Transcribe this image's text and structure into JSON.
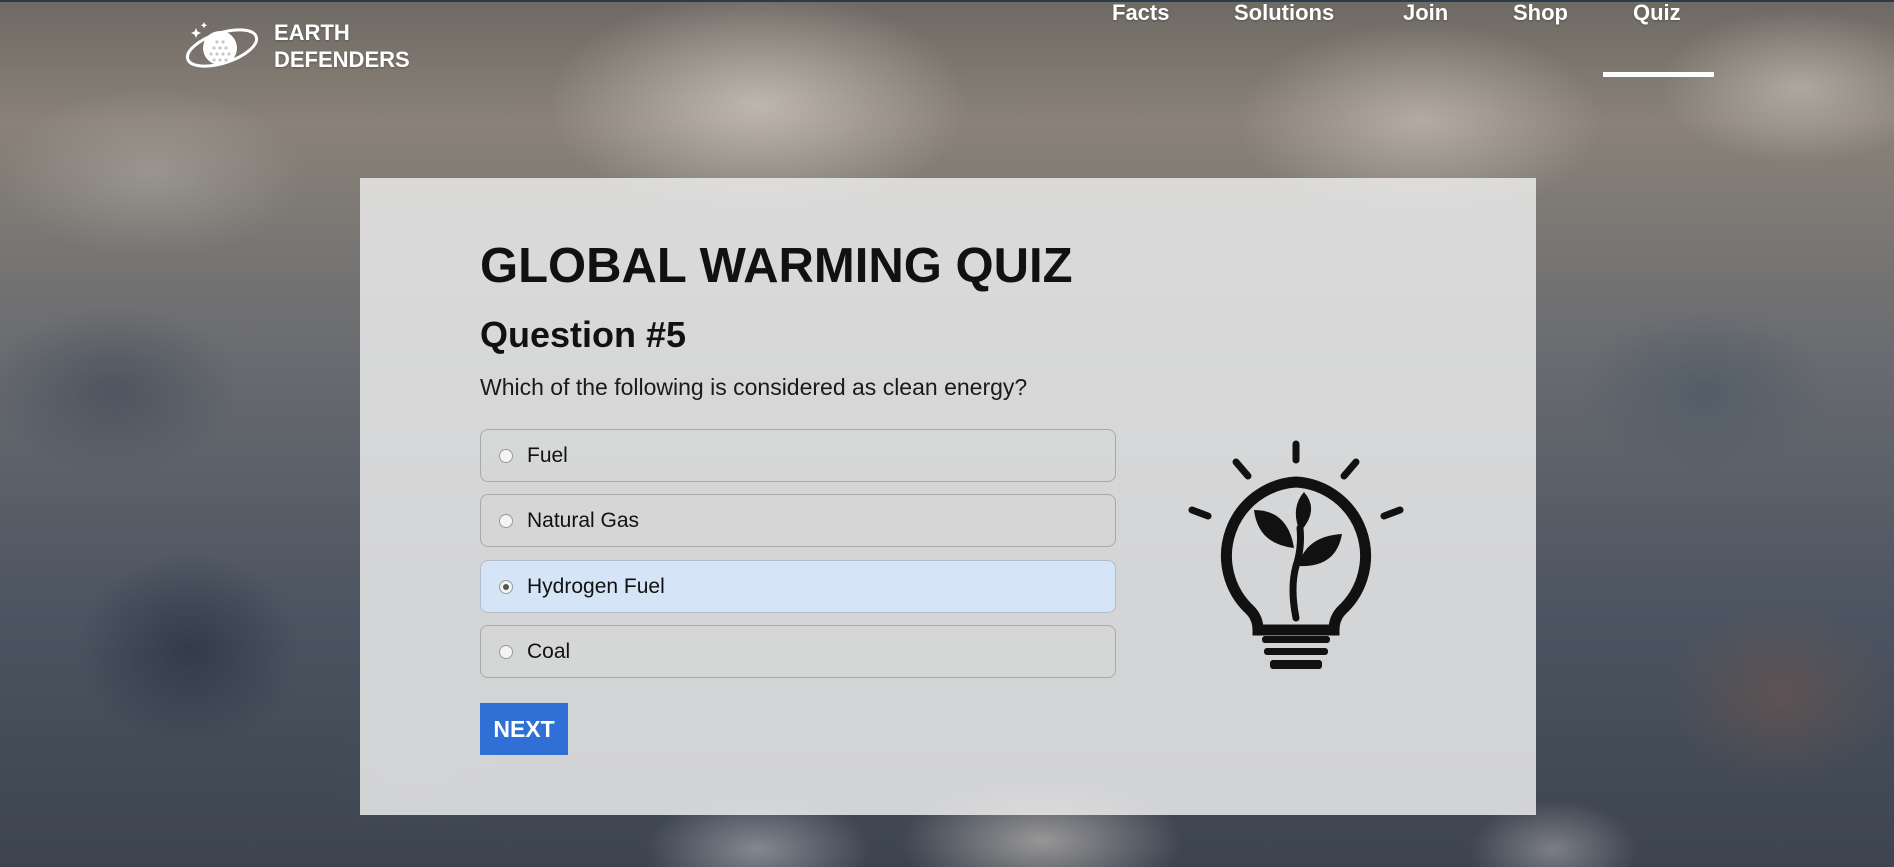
{
  "brand": {
    "line1": "EARTH",
    "line2": "DEFENDERS",
    "logo_icon": "planet-icon"
  },
  "nav": {
    "items": [
      {
        "label": "Facts"
      },
      {
        "label": "Solutions"
      },
      {
        "label": "Join"
      },
      {
        "label": "Shop"
      },
      {
        "label": "Quiz"
      }
    ],
    "active": "Quiz"
  },
  "quiz": {
    "title": "GLOBAL WARMING QUIZ",
    "question_number": "Question #5",
    "question_text": "Which of the following is considered as clean energy?",
    "options": [
      {
        "label": "Fuel",
        "selected": false
      },
      {
        "label": "Natural Gas",
        "selected": false
      },
      {
        "label": "Hydrogen Fuel",
        "selected": true
      },
      {
        "label": "Coal",
        "selected": false
      }
    ],
    "next_label": "NEXT",
    "illustration_icon": "lightbulb-plant-icon"
  },
  "colors": {
    "accent": "#2f6fd6",
    "selected_option_bg": "#d6e4f7",
    "card_bg": "#e8e8e8"
  }
}
